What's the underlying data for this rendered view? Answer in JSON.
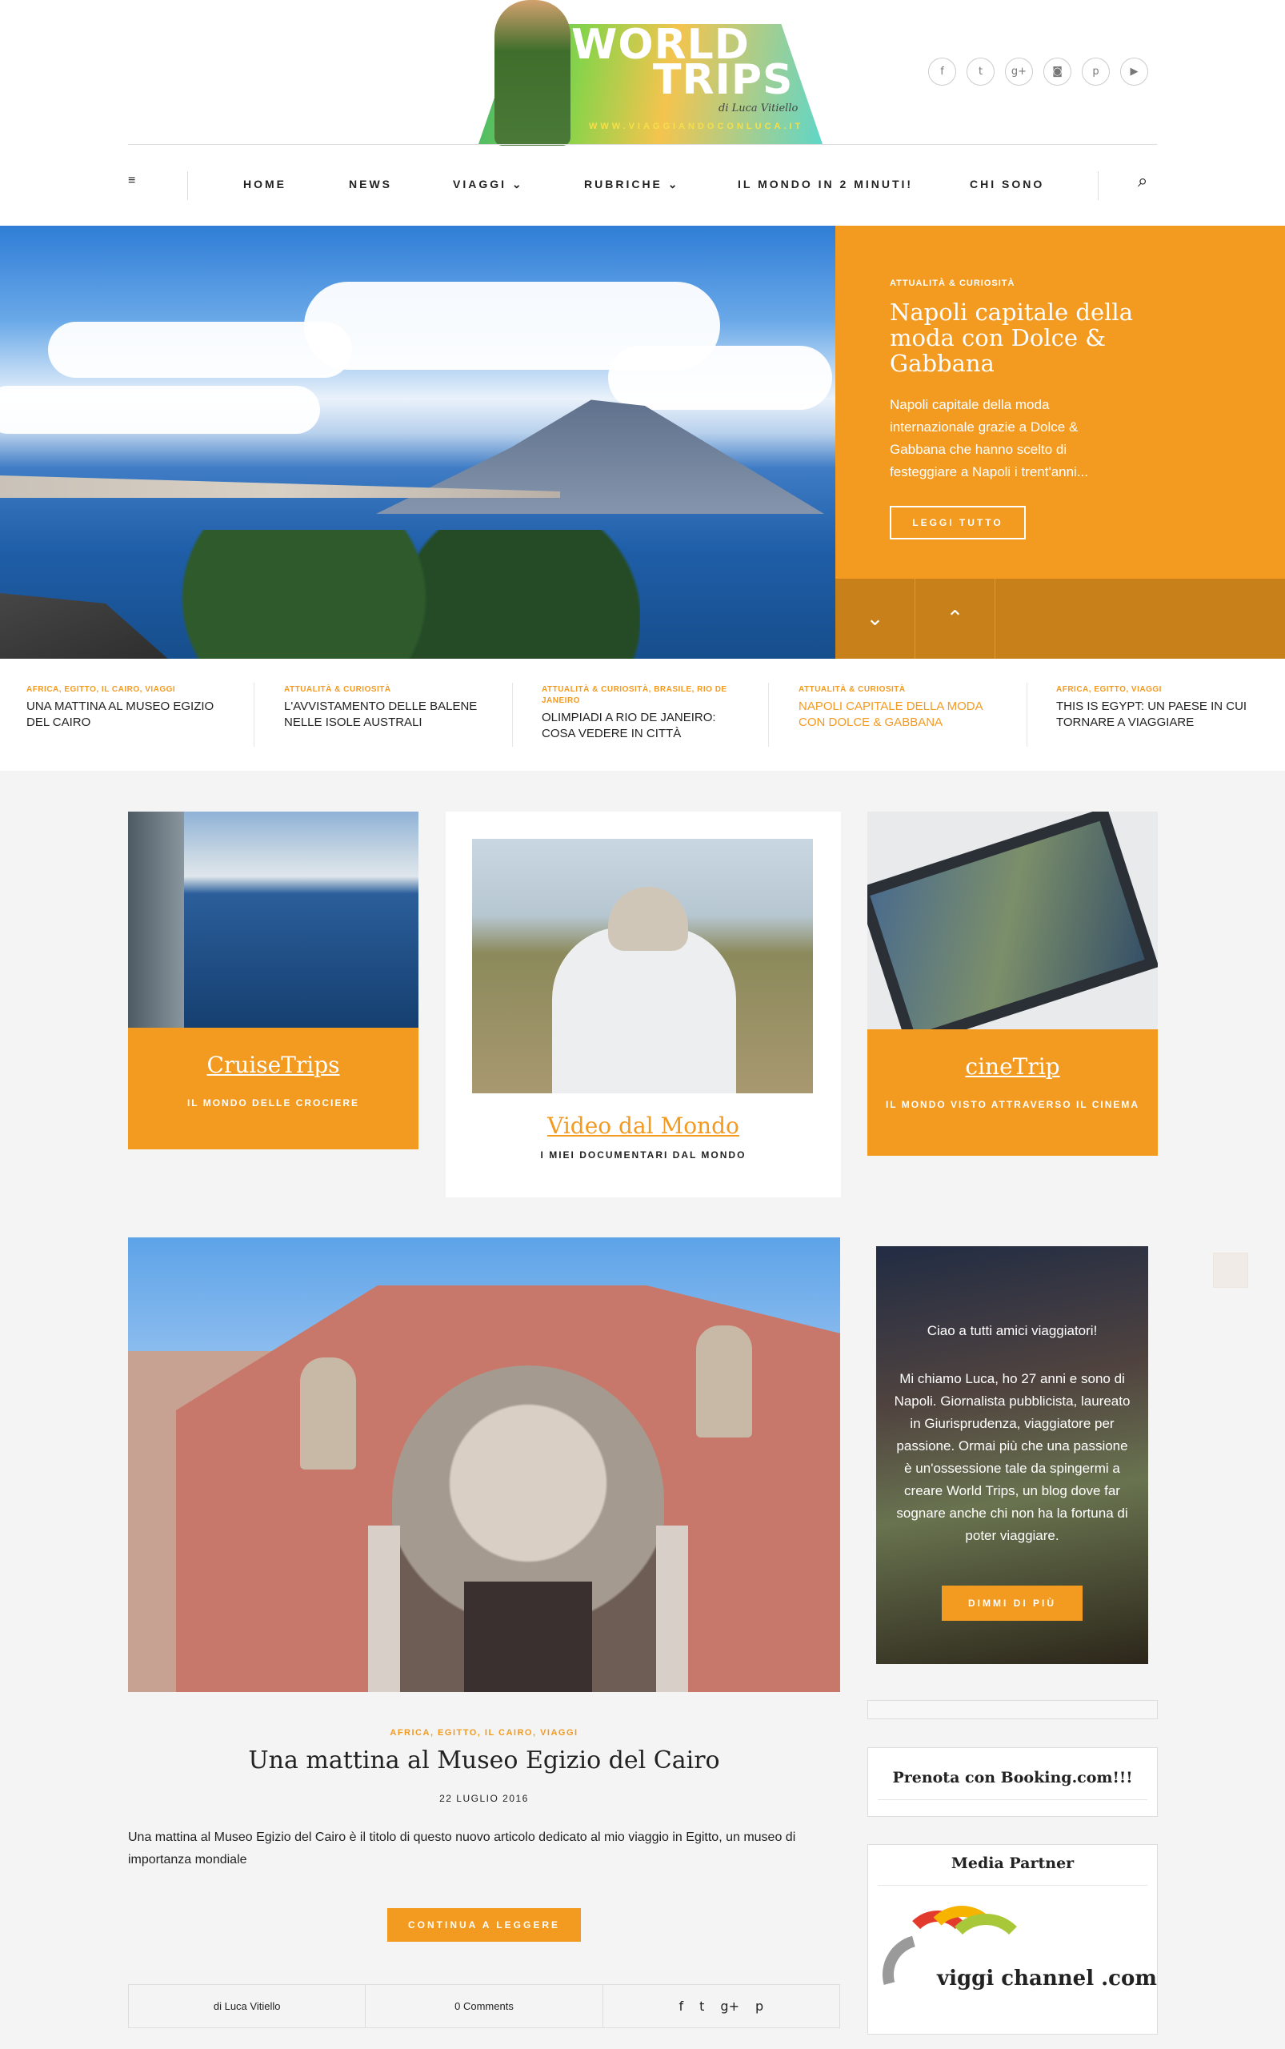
{
  "brand": {
    "logo_word1": "WORLD",
    "logo_word2": "TRIPS",
    "logo_signature": "di Luca Vitiello",
    "logo_url": "WWW.VIAGGIANDOCONLUCA.IT",
    "accent_color": "#f39a21"
  },
  "social": {
    "icons": [
      "facebook-icon",
      "twitter-icon",
      "google-plus-icon",
      "instagram-icon",
      "pinterest-icon",
      "youtube-icon"
    ],
    "glyphs": [
      "f",
      "t",
      "g+",
      "◙",
      "p",
      "▶"
    ]
  },
  "nav": {
    "items": [
      "HOME",
      "NEWS",
      "VIAGGI ⌄",
      "RUBRICHE ⌄",
      "IL MONDO IN 2 MINUTI!",
      "CHI SONO"
    ],
    "menu_glyph": "≡",
    "search_glyph": "⌕"
  },
  "hero": {
    "category": "ATTUALITÀ & CURIOSITÀ",
    "title": "Napoli capitale della moda con Dolce & Gabbana",
    "excerpt": "Napoli capitale della moda internazionale grazie a Dolce & Gabbana che hanno scelto di festeggiare a Napoli i trent'anni...",
    "button": "LEGGI TUTTO",
    "arrow_down": "⌄",
    "arrow_up": "⌃"
  },
  "ticker": [
    {
      "category": "AFRICA, EGITTO, IL CAIRO, VIAGGI",
      "title": "UNA MATTINA AL MUSEO EGIZIO DEL CAIRO"
    },
    {
      "category": "ATTUALITÀ & CURIOSITÀ",
      "title": "L'AVVISTAMENTO DELLE BALENE NELLE ISOLE AUSTRALI"
    },
    {
      "category": "ATTUALITÀ & CURIOSITÀ, BRASILE, RIO DE JANEIRO",
      "title": "OLIMPIADI A RIO DE JANEIRO: COSA VEDERE IN CITTÀ"
    },
    {
      "category": "ATTUALITÀ & CURIOSITÀ",
      "title": "NAPOLI CAPITALE DELLA MODA CON DOLCE & GABBANA"
    },
    {
      "category": "AFRICA, EGITTO, VIAGGI",
      "title": "THIS IS EGYPT: UN PAESE IN CUI TORNARE A VIAGGIARE"
    }
  ],
  "cards": [
    {
      "title": "CruiseTrips",
      "subtitle": "IL MONDO DELLE CROCIERE"
    },
    {
      "title": "Video dal Mondo",
      "subtitle": "I MIEI DOCUMENTARI DAL MONDO"
    },
    {
      "title": "cineTrip",
      "subtitle": "IL MONDO VISTO ATTRAVERSO IL CINEMA"
    }
  ],
  "post": {
    "categories": "AFRICA, EGITTO, IL CAIRO, VIAGGI",
    "title": "Una mattina al Museo Egizio del Cairo",
    "date": "22 LUGLIO 2016",
    "excerpt": "Una mattina al Museo Egizio del Cairo è il titolo di questo nuovo articolo dedicato al mio viaggio in Egitto, un museo di importanza mondiale",
    "button": "CONTINUA A LEGGERE",
    "author": "di Luca Vitiello",
    "comments": "0 Comments",
    "share_glyphs": [
      "f",
      "t",
      "g+",
      "p"
    ]
  },
  "sidebar": {
    "about_greeting": "Ciao a tutti amici viaggiatori!",
    "about_text": "Mi chiamo Luca, ho 27 anni e sono di Napoli. Giornalista pubblicista, laureato in Giurisprudenza, viaggiatore per passione. Ormai più che una passione è un'ossessione tale da spingermi a creare World Trips, un blog dove far sognare anche chi non ha la fortuna di poter viaggiare.",
    "about_button": "DIMMI DI PIÙ",
    "booking_title": "Prenota con Booking.com!!!",
    "media_title": "Media Partner",
    "media_logo_text": "viggi channel .com"
  }
}
